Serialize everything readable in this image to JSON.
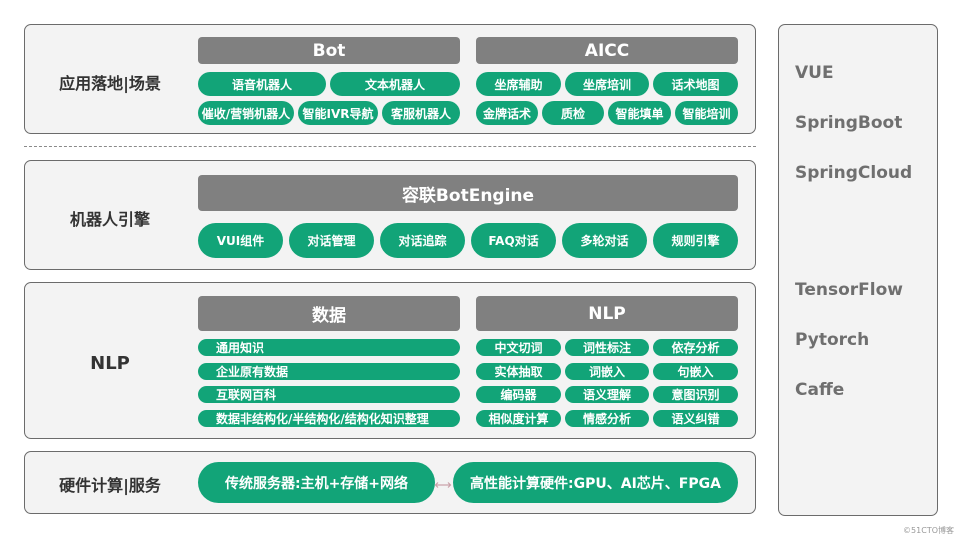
{
  "layers": {
    "application": {
      "label": "应用落地|场景",
      "bot": {
        "title": "Bot",
        "items": [
          "语音机器人",
          "文本机器人",
          "催收/营销机器人",
          "智能IVR导航",
          "客服机器人"
        ]
      },
      "aicc": {
        "title": "AICC",
        "items": [
          "坐席辅助",
          "坐席培训",
          "话术地图",
          "金牌话术",
          "质检",
          "智能填单",
          "智能培训"
        ]
      }
    },
    "engine": {
      "label": "机器人引擎",
      "title": "容联BotEngine",
      "items": [
        "VUI组件",
        "对话管理",
        "对话追踪",
        "FAQ对话",
        "多轮对话",
        "规则引擎"
      ]
    },
    "nlp": {
      "label": "NLP",
      "data": {
        "title": "数据",
        "items": [
          "通用知识",
          "企业原有数据",
          "互联网百科",
          "数据非结构化/半结构化/结构化知识整理"
        ]
      },
      "nlp_block": {
        "title": "NLP",
        "items": [
          "中文切词",
          "词性标注",
          "依存分析",
          "实体抽取",
          "词嵌入",
          "句嵌入",
          "编码器",
          "语义理解",
          "意图识别",
          "相似度计算",
          "情感分析",
          "语义纠错"
        ]
      }
    },
    "hardware": {
      "label": "硬件计算|服务",
      "items": [
        "传统服务器:主机+存储+网络",
        "高性能计算硬件:GPU、AI芯片、FPGA"
      ]
    }
  },
  "side_panel": {
    "items": [
      "VUE",
      "SpringBoot",
      "SpringCloud",
      "TensorFlow",
      "Pytorch",
      "Caffe"
    ]
  },
  "watermark": "©51CTO博客",
  "colors": {
    "accent_green": "#12a478",
    "header_gray": "#808080",
    "panel_bg": "#f3f3f3"
  }
}
